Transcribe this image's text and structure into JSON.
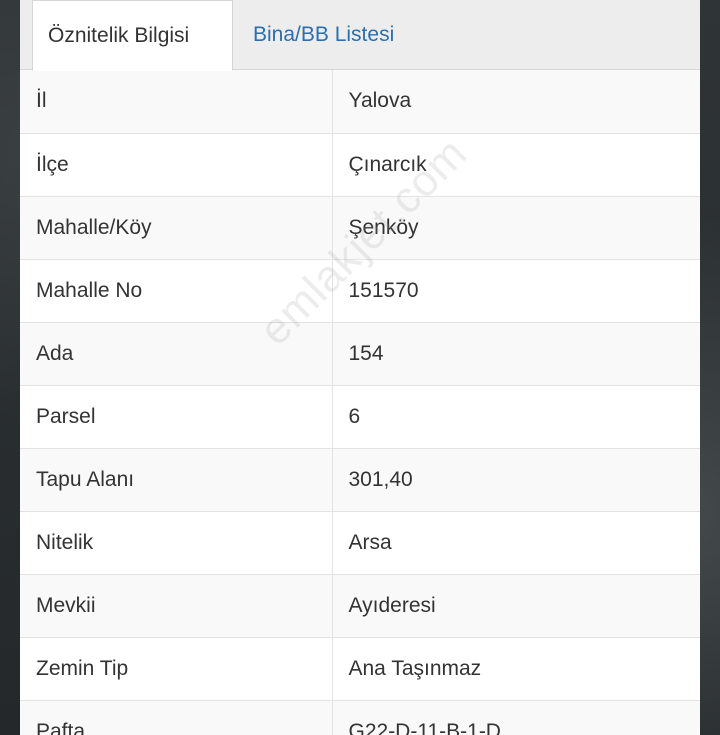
{
  "tabs": [
    {
      "label": "Öznitelik Bilgisi",
      "active": true
    },
    {
      "label": "Bina/BB Listesi",
      "active": false
    }
  ],
  "rows": [
    {
      "key": "İl",
      "value": "Yalova"
    },
    {
      "key": "İlçe",
      "value": "Çınarcık"
    },
    {
      "key": "Mahalle/Köy",
      "value": "Şenköy"
    },
    {
      "key": "Mahalle No",
      "value": "151570"
    },
    {
      "key": "Ada",
      "value": "154"
    },
    {
      "key": "Parsel",
      "value": "6"
    },
    {
      "key": "Tapu Alanı",
      "value": "301,40"
    },
    {
      "key": "Nitelik",
      "value": "Arsa"
    },
    {
      "key": "Mevkii",
      "value": "Ayıderesi"
    },
    {
      "key": "Zemin Tip",
      "value": "Ana Taşınmaz"
    },
    {
      "key": "Pafta",
      "value": "G22-D-11-B-1-D"
    }
  ],
  "watermark": "emlakjet.com",
  "colors": {
    "tab_link": "#2a6fb0",
    "stripe": "#f9f9f9",
    "border": "#e3e3e3"
  }
}
